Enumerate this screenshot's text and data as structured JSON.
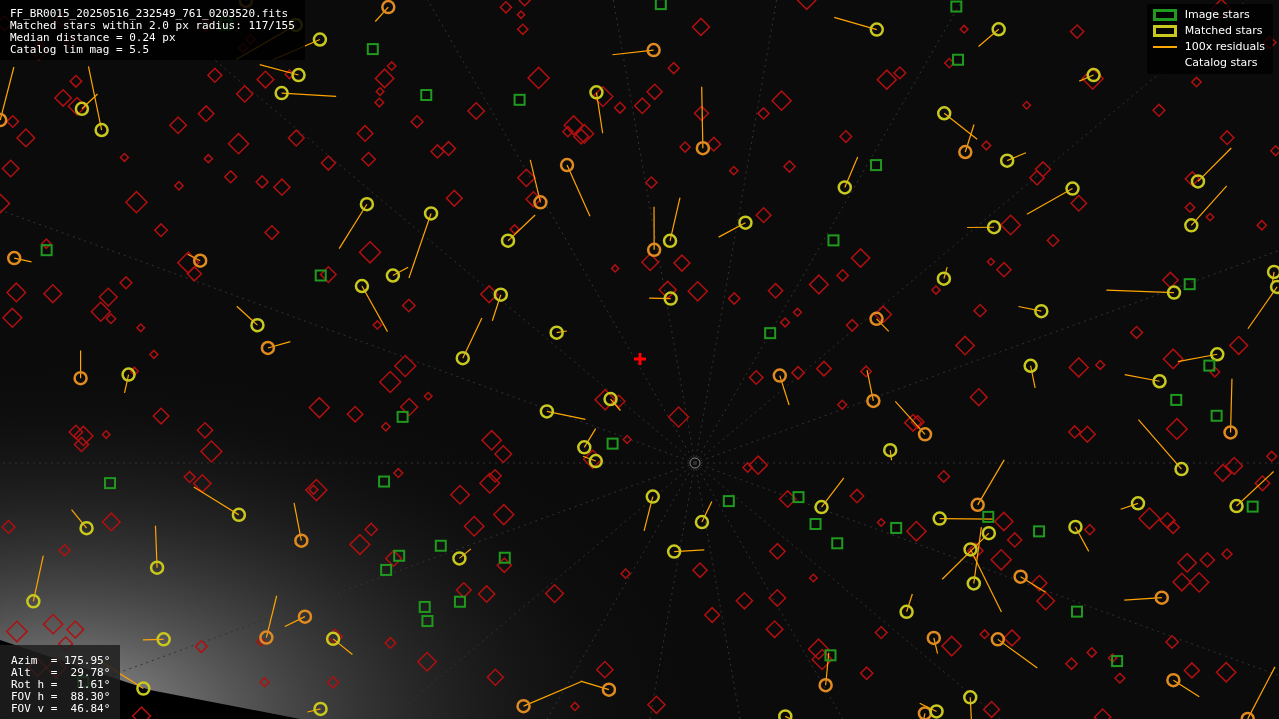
{
  "header": [
    "FF_BR0015_20250516_232549_761_0203520.fits",
    "Matched stars within 2.0 px radius: 117/155",
    "Median distance = 0.24 px",
    "Catalog lim mag = 5.5"
  ],
  "legend": [
    {
      "label": "Image stars",
      "kind": "box",
      "color": "#1f9a1f"
    },
    {
      "label": "Matched stars",
      "kind": "box",
      "color": "#c8c81e"
    },
    {
      "label": "100x residuals",
      "kind": "line",
      "color": "#ffa500"
    },
    {
      "label": "Catalog stars",
      "kind": "none"
    }
  ],
  "pointing": [
    "Azim  = 175.95°",
    "Alt   =  29.78°",
    "Rot h =   1.61°",
    "FOV h =  88.30°",
    "FOV v =  46.84°"
  ]
}
